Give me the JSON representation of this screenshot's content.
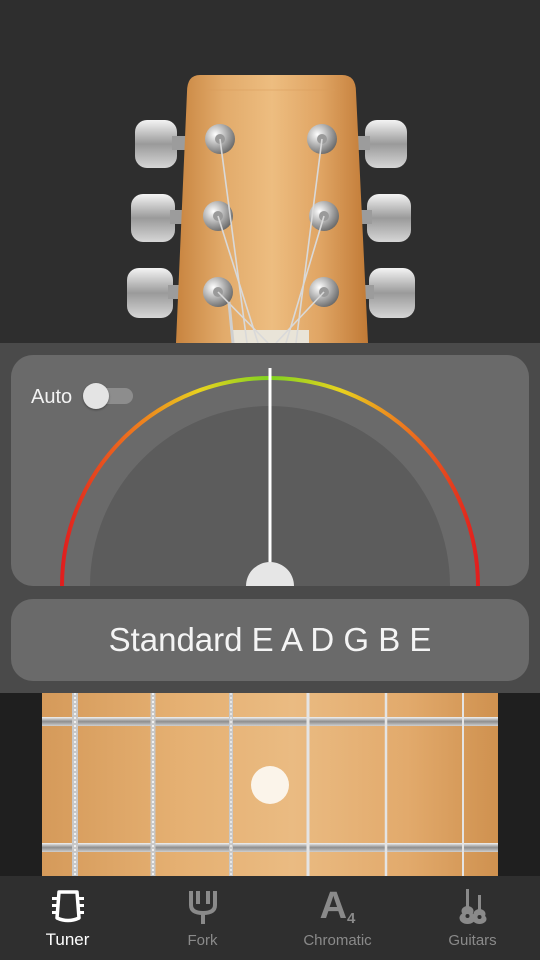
{
  "tuner": {
    "auto_label": "Auto",
    "auto_enabled": false,
    "needle_cents": 0,
    "tuning_name": "Standard E A D G B E"
  },
  "tabs": [
    {
      "label": "Tuner",
      "icon": "tuner-icon",
      "active": true
    },
    {
      "label": "Fork",
      "icon": "tuning-fork-icon",
      "active": false
    },
    {
      "label": "Chromatic",
      "icon": "chromatic-a4-icon",
      "active": false
    },
    {
      "label": "Guitars",
      "icon": "guitars-icon",
      "active": false
    }
  ],
  "chromatic_icon": {
    "letter": "A",
    "subscript": "4"
  },
  "colors": {
    "gauge_low": "#e01e1e",
    "gauge_mid": "#e8d21e",
    "gauge_center": "#7ed321"
  }
}
